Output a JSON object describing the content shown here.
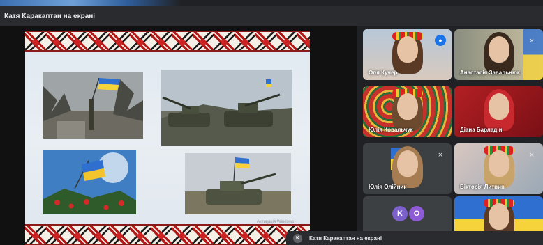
{
  "window": {
    "title": "Катя Каракаптан на екрані"
  },
  "slide": {
    "watermark": "Активація Windows · перейдіть у розділ"
  },
  "participants": [
    {
      "name": "Оля Кучер",
      "mic": "speaking",
      "active": true
    },
    {
      "name": "Анастасія Завальнюк",
      "mic": "muted",
      "active": false
    },
    {
      "name": "Юлія Ковальчук",
      "mic": "none",
      "active": false
    },
    {
      "name": "Діана Барладін",
      "mic": "none",
      "active": false
    },
    {
      "name": "Юлія Олійник",
      "mic": "muted",
      "active": false
    },
    {
      "name": "Вікторія Литвин",
      "mic": "muted",
      "active": false
    }
  ],
  "avatars": [
    {
      "letter": "K",
      "color": "#7b61c9"
    },
    {
      "letter": "O",
      "color": "#8e5bd6"
    }
  ],
  "bottom_window": {
    "avatar_letter": "K",
    "title": "Катя Каракаптан на екрані"
  },
  "icons": {
    "mic_on": "mic-active-icon",
    "mic_off": "mic-off-icon"
  }
}
